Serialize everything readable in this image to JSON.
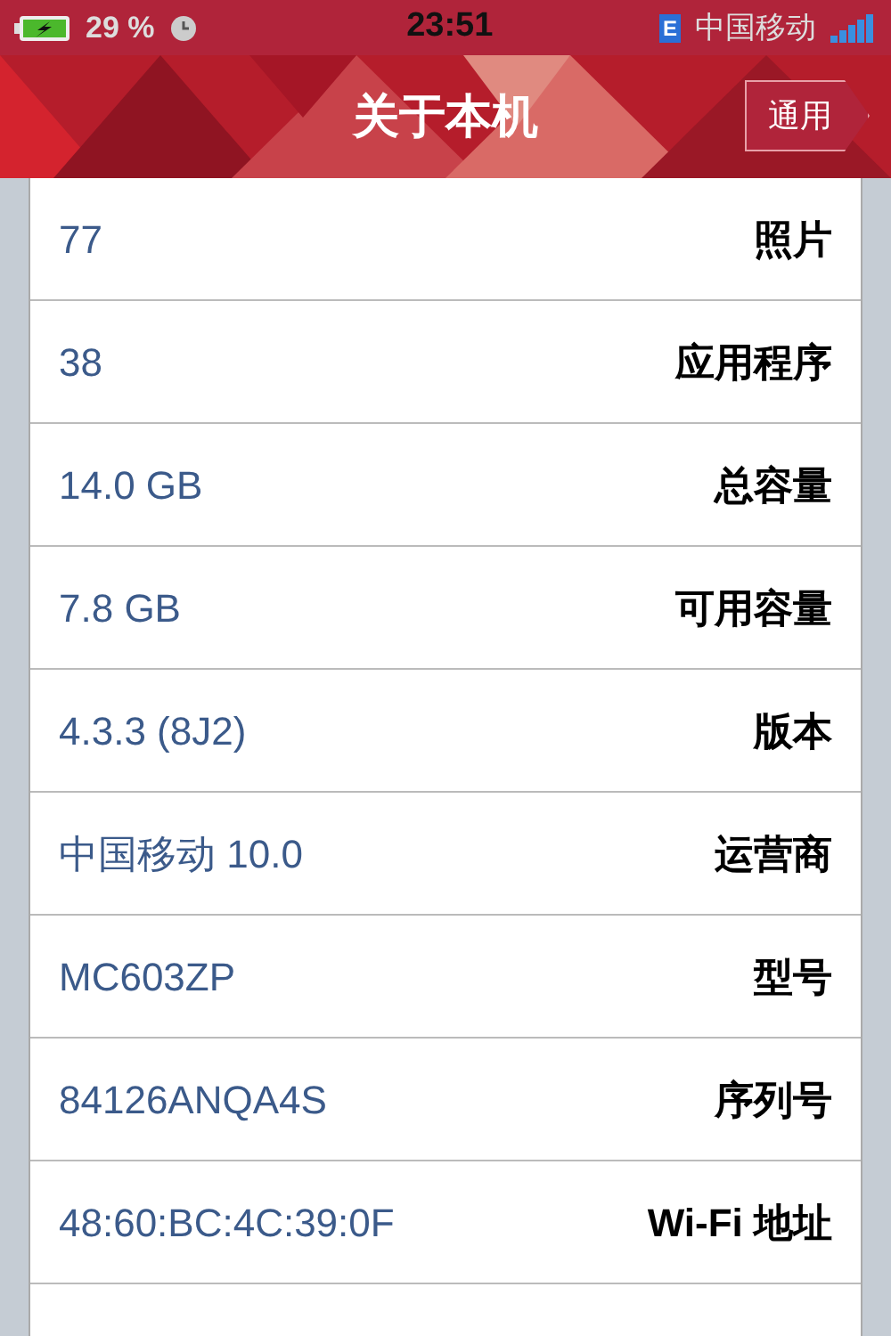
{
  "status_bar": {
    "battery": "29 %",
    "time": "23:51",
    "network": "E",
    "carrier": "中国移动"
  },
  "nav": {
    "title": "关于本机",
    "back": "通用"
  },
  "rows": [
    {
      "label": "照片",
      "value": "77"
    },
    {
      "label": "应用程序",
      "value": "38"
    },
    {
      "label": "总容量",
      "value": "14.0 GB"
    },
    {
      "label": "可用容量",
      "value": "7.8 GB"
    },
    {
      "label": "版本",
      "value": "4.3.3 (8J2)"
    },
    {
      "label": "运营商",
      "value": "中国移动 10.0"
    },
    {
      "label": "型号",
      "value": "MC603ZP"
    },
    {
      "label": "序列号",
      "value": "84126ANQA4S"
    },
    {
      "label": "Wi-Fi 地址",
      "value": "48:60:BC:4C:39:0F"
    }
  ]
}
